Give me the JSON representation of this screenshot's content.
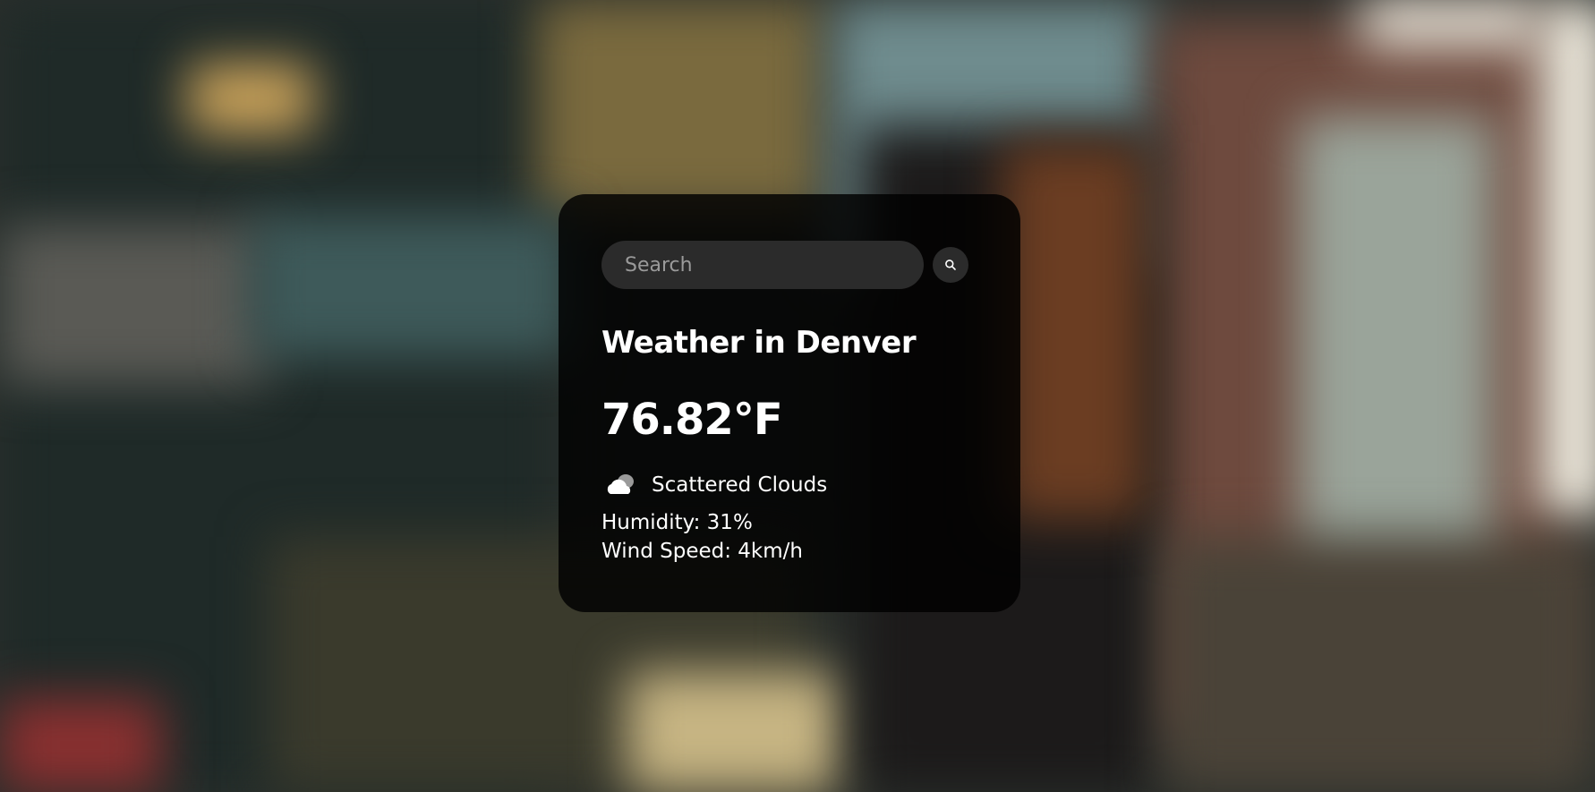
{
  "search": {
    "placeholder": "Search",
    "button_icon": "search-icon"
  },
  "weather": {
    "title": "Weather in Denver",
    "temperature": "76.82°F",
    "condition_icon": "cloud-icon",
    "description": "Scattered Clouds",
    "humidity": "Humidity: 31%",
    "wind": "Wind Speed: 4km/h"
  },
  "colors": {
    "card_background": "#000000",
    "text": "#ffffff",
    "input_background": "#2b2b2b"
  }
}
